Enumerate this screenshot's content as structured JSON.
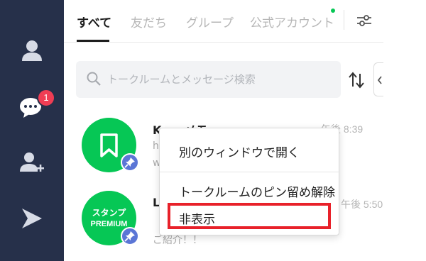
{
  "nav": {
    "chat_badge_count": "1",
    "icons": [
      "profile-icon",
      "chat-bubble-icon",
      "add-friend-icon",
      "play-icon"
    ]
  },
  "tabs": [
    {
      "label": "すべて",
      "active": true
    },
    {
      "label": "友だち",
      "active": false
    },
    {
      "label": "グループ",
      "active": false
    },
    {
      "label": "公式アカウント",
      "active": false
    }
  ],
  "search": {
    "placeholder": "トークルームとメッセージ検索",
    "value": ""
  },
  "chats": [
    {
      "name": "Keepメモ",
      "time": "午後 8:39",
      "preview": "h",
      "preview2": "w",
      "avatar": "bookmark-icon",
      "pinned": true
    },
    {
      "name": "L",
      "time": "午後 5:50",
      "preview": "【",
      "preview2": "ご紹介！！",
      "avatar_line1": "スタンプ",
      "avatar_line2": "PREMIUM",
      "pinned": true
    }
  ],
  "context_menu": {
    "items": [
      "別のウィンドウで開く",
      "トークルームのピン留め解除",
      "非表示"
    ],
    "highlighted": "非表示"
  },
  "colors": {
    "rail": "#26304a",
    "accent_green": "#06c755",
    "badge_red": "#ef3d54",
    "pin_blue": "#5b76d6",
    "highlight_red": "#e8212a"
  }
}
